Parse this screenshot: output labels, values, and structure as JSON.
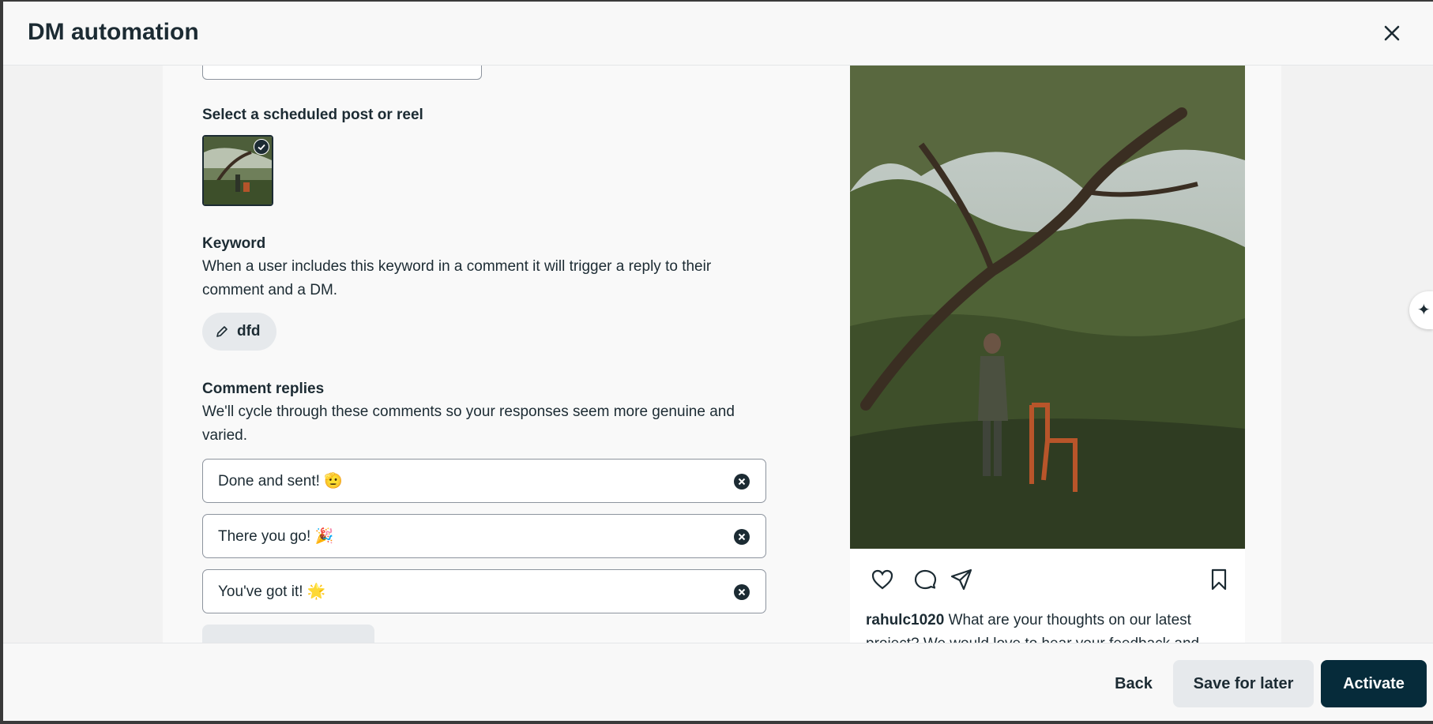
{
  "header": {
    "title": "DM automation",
    "close_icon": "close-icon"
  },
  "post_select": {
    "label": "Select a scheduled post or reel",
    "selected": true
  },
  "keyword": {
    "label": "Keyword",
    "description": "When a user includes this keyword in a comment it will trigger a reply to their comment and a DM.",
    "value": "dfd",
    "icon": "pencil-icon"
  },
  "comment_replies": {
    "label": "Comment replies",
    "description": "We'll cycle through these comments so your responses seem more genuine and varied.",
    "items": [
      {
        "text": "Done and sent! 🫡"
      },
      {
        "text": "There you go! 🎉"
      },
      {
        "text": "You've got it! 🌟"
      }
    ]
  },
  "preview": {
    "username": "rahulc1020",
    "caption": "What are your thoughts on our latest project? We would love to hear your feedback and",
    "icons": [
      "heart-icon",
      "comment-icon",
      "share-icon",
      "bookmark-icon"
    ]
  },
  "side_button": {
    "icon": "sparkle-icon",
    "glyph": "✦"
  },
  "footer": {
    "back_label": "Back",
    "save_label": "Save for later",
    "activate_label": "Activate"
  },
  "colors": {
    "primary": "#062b3a",
    "secondary_bg": "#e6e9ec",
    "text": "#1c2b33"
  }
}
